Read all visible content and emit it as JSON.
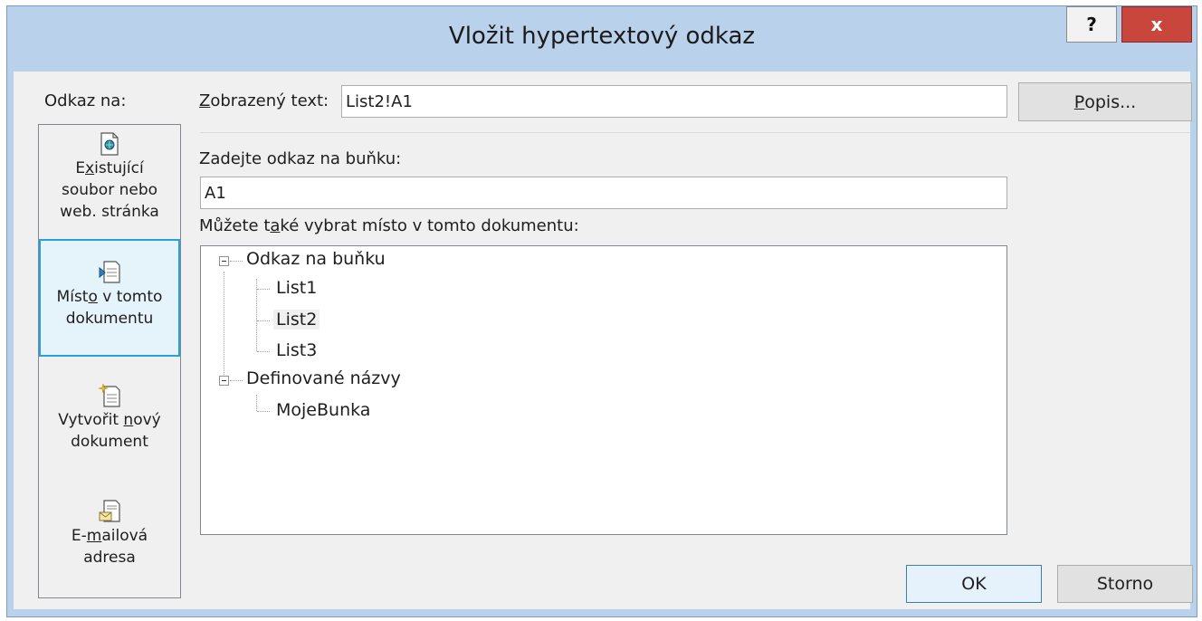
{
  "window": {
    "title": "Vložit hypertextový odkaz",
    "help_label": "?",
    "close_label": "x"
  },
  "sidebar": {
    "heading": "Odkaz na:",
    "items": [
      {
        "line1_pre": "E",
        "line1_u": "x",
        "line1_post": "istující",
        "line2": "soubor nebo",
        "line3": "web. stránka",
        "icon": "existing-file-icon"
      },
      {
        "line1_pre": "Míst",
        "line1_u": "o",
        "line1_post": " v tomto",
        "line2": "dokumentu",
        "icon": "place-in-document-icon"
      },
      {
        "line1_pre": "Vytvořit ",
        "line1_u": "n",
        "line1_post": "ový",
        "line2": "dokument",
        "icon": "new-document-icon"
      },
      {
        "line1_pre": "E-",
        "line1_u": "m",
        "line1_post": "ailová",
        "line2": "adresa",
        "icon": "email-address-icon"
      }
    ]
  },
  "display_text": {
    "label_u": "Z",
    "label_rest": "obrazený text:",
    "value": "List2!A1"
  },
  "screentip_button": {
    "label_u": "P",
    "label_rest": "opis..."
  },
  "cell_reference": {
    "label_pre": "Zade",
    "label_u": "j",
    "label_post": "te odkaz na buňku:",
    "value": "A1"
  },
  "place_list": {
    "label_pre": "Můžete t",
    "label_u": "a",
    "label_post": "ké vybrat místo v tomto dokumentu:",
    "groups": [
      {
        "label": "Odkaz na buňku",
        "children": [
          "List1",
          "List2",
          "List3"
        ]
      },
      {
        "label": "Definované názvy",
        "children": [
          "MojeBunka"
        ]
      }
    ]
  },
  "buttons": {
    "ok": "OK",
    "cancel": "Storno"
  },
  "colors": {
    "accent": "#26a0da",
    "close": "#c9463d",
    "titlebar": "#b9d1ea"
  }
}
